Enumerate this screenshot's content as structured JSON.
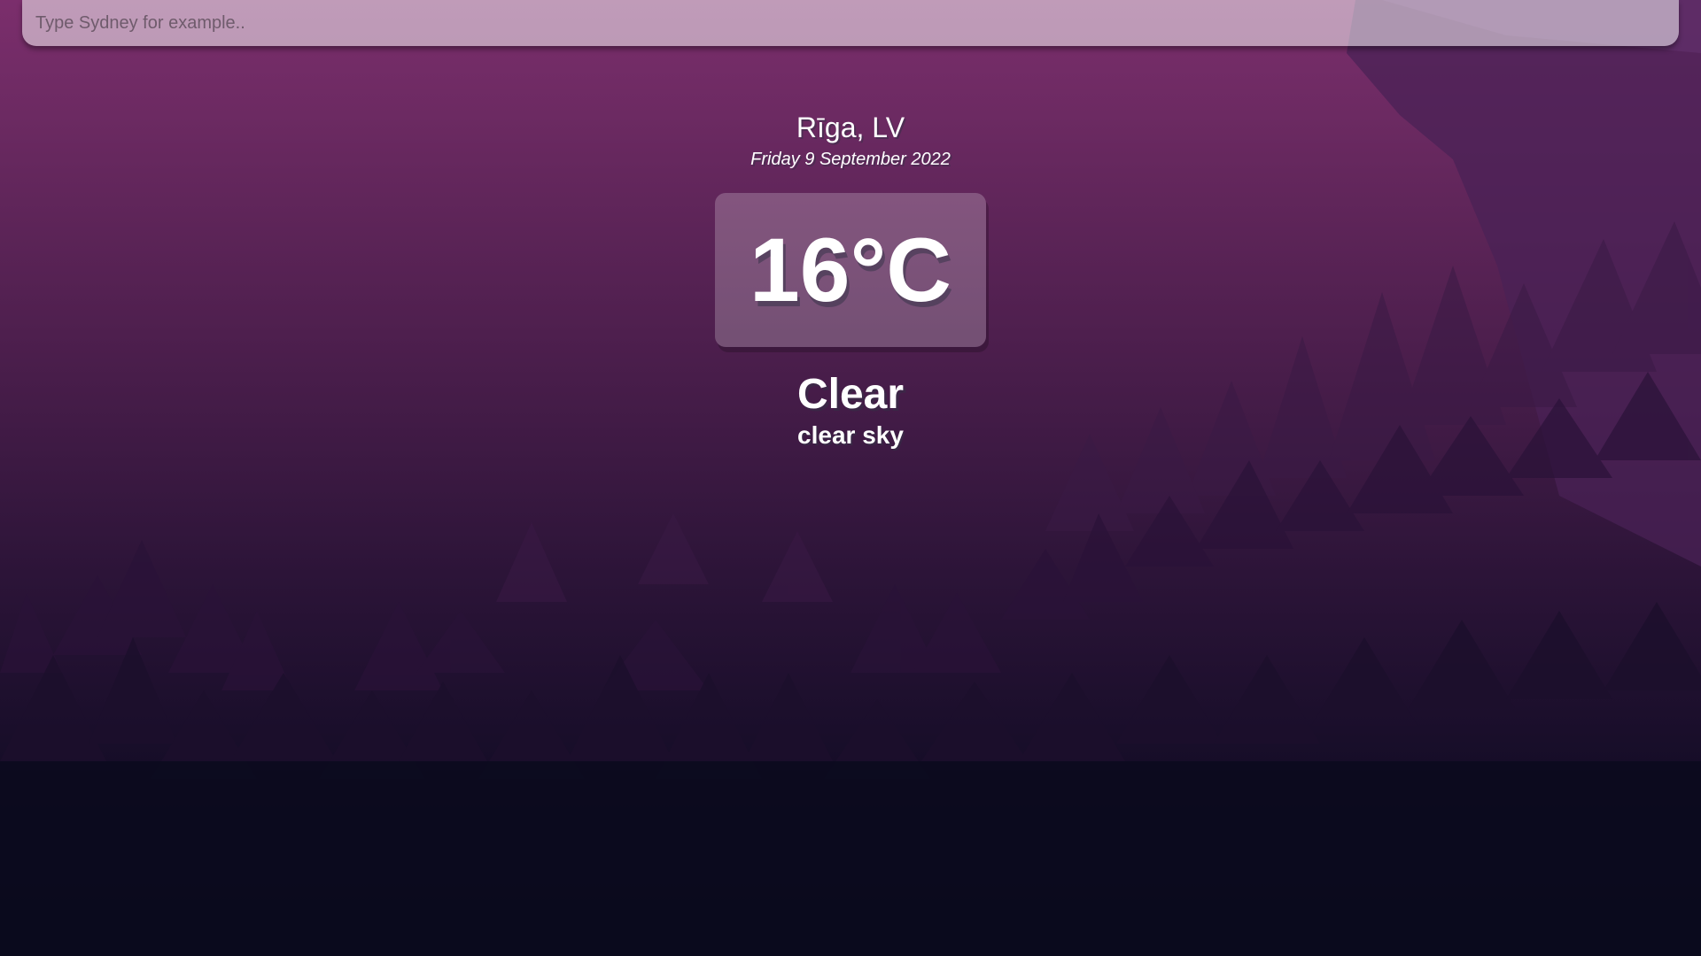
{
  "search": {
    "placeholder": "Type Sydney for example.."
  },
  "location": {
    "city": "Rīga, LV",
    "date": "Friday 9 September 2022"
  },
  "weather": {
    "temperature": "16°C",
    "condition": "Clear",
    "description": "clear sky"
  },
  "background": {
    "scene": "forest-mountain-landscape",
    "colors": {
      "top": "#7b2e6c",
      "middle": "#4e1f4e",
      "bottom": "#0a0a1c"
    }
  }
}
